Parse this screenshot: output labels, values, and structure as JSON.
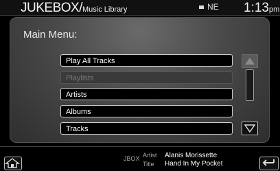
{
  "header": {
    "title_main": "JUKEBOX/",
    "title_sub": "Music Library",
    "status_text": "NE",
    "clock_time": "1:13",
    "clock_ampm": "pm"
  },
  "menu": {
    "title": "Main Menu:",
    "items": [
      {
        "label": "Play All Tracks",
        "enabled": true
      },
      {
        "label": "Playlists",
        "enabled": false
      },
      {
        "label": "Artists",
        "enabled": true
      },
      {
        "label": "Albums",
        "enabled": true
      },
      {
        "label": "Tracks",
        "enabled": true
      }
    ]
  },
  "now_playing": {
    "source": "JBOX",
    "artist_label": "Artist",
    "artist": "Alanis Morissette",
    "title_label": "Title",
    "title": "Hand In My Pocket"
  },
  "icons": {
    "home": "home-icon",
    "back": "back-icon",
    "up": "up-arrow-icon",
    "down": "down-arrow-icon"
  }
}
